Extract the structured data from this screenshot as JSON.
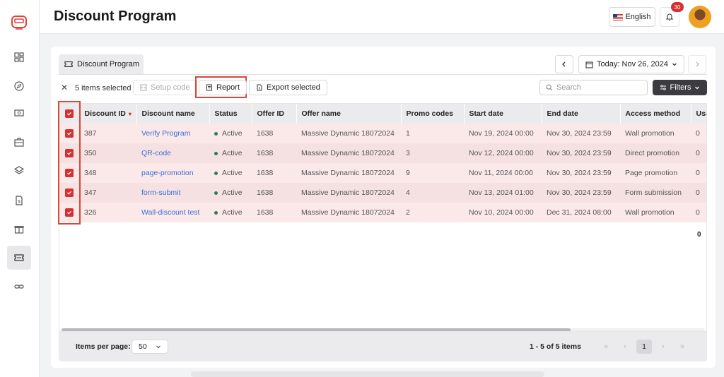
{
  "header": {
    "title": "Discount Program",
    "language": "English",
    "notification_count": "30"
  },
  "sidebar": {
    "items": [
      {
        "name": "dashboard-icon",
        "active": false
      },
      {
        "name": "compass-icon",
        "active": false
      },
      {
        "name": "money-icon",
        "active": false
      },
      {
        "name": "briefcase-icon",
        "active": false
      },
      {
        "name": "layers-icon",
        "active": false
      },
      {
        "name": "dollar-file-icon",
        "active": false
      },
      {
        "name": "gift-icon",
        "active": false
      },
      {
        "name": "ticket-icon",
        "active": true
      },
      {
        "name": "link-icon",
        "active": false
      }
    ]
  },
  "tabs": [
    {
      "label": "Discount Program"
    }
  ],
  "date_nav": {
    "label": "Today: Nov 26, 2024"
  },
  "toolbar": {
    "selected_count": "5 items selected",
    "setup_code": "Setup code",
    "report": "Report",
    "export_selected": "Export selected",
    "search_placeholder": "Search",
    "filters": "Filters"
  },
  "table": {
    "columns": [
      "Discount ID",
      "Discount name",
      "Status",
      "Offer ID",
      "Offer name",
      "Promo codes",
      "Start date",
      "End date",
      "Access method",
      "Usa"
    ],
    "rows": [
      {
        "id": "387",
        "name": "Verify Program",
        "status": "Active",
        "offer_id": "1638",
        "offer_name": "Massive Dynamic 18072024",
        "promo_codes": "1",
        "start": "Nov 19, 2024 00:00",
        "end": "Nov 30, 2024 23:59",
        "access": "Wall promotion",
        "usage": "0"
      },
      {
        "id": "350",
        "name": "QR-code",
        "status": "Active",
        "offer_id": "1638",
        "offer_name": "Massive Dynamic 18072024",
        "promo_codes": "3",
        "start": "Nov 12, 2024 00:00",
        "end": "Nov 30, 2024 23:59",
        "access": "Direct promotion",
        "usage": "0"
      },
      {
        "id": "348",
        "name": "page-promotion",
        "status": "Active",
        "offer_id": "1638",
        "offer_name": "Massive Dynamic 18072024",
        "promo_codes": "9",
        "start": "Nov 11, 2024 00:00",
        "end": "Nov 30, 2024 23:59",
        "access": "Page promotion",
        "usage": "0"
      },
      {
        "id": "347",
        "name": "form-submit",
        "status": "Active",
        "offer_id": "1638",
        "offer_name": "Massive Dynamic 18072024",
        "promo_codes": "4",
        "start": "Nov 13, 2024 01:00",
        "end": "Nov 30, 2024 23:59",
        "access": "Form submission",
        "usage": "0"
      },
      {
        "id": "326",
        "name": "Wall-discount test",
        "status": "Active",
        "offer_id": "1638",
        "offer_name": "Massive Dynamic 18072024",
        "promo_codes": "2",
        "start": "Nov 10, 2024 00:00",
        "end": "Dec 31, 2024 08:00",
        "access": "Wall promotion",
        "usage": "0"
      }
    ],
    "total": "0"
  },
  "pagination": {
    "items_per_page_label": "Items per page:",
    "items_per_page": "50",
    "range": "1 - 5 of 5 items",
    "current_page": "1"
  },
  "colors": {
    "accent": "#d63031",
    "link": "#3b6fd0",
    "active_dot": "#2e7d4f"
  }
}
